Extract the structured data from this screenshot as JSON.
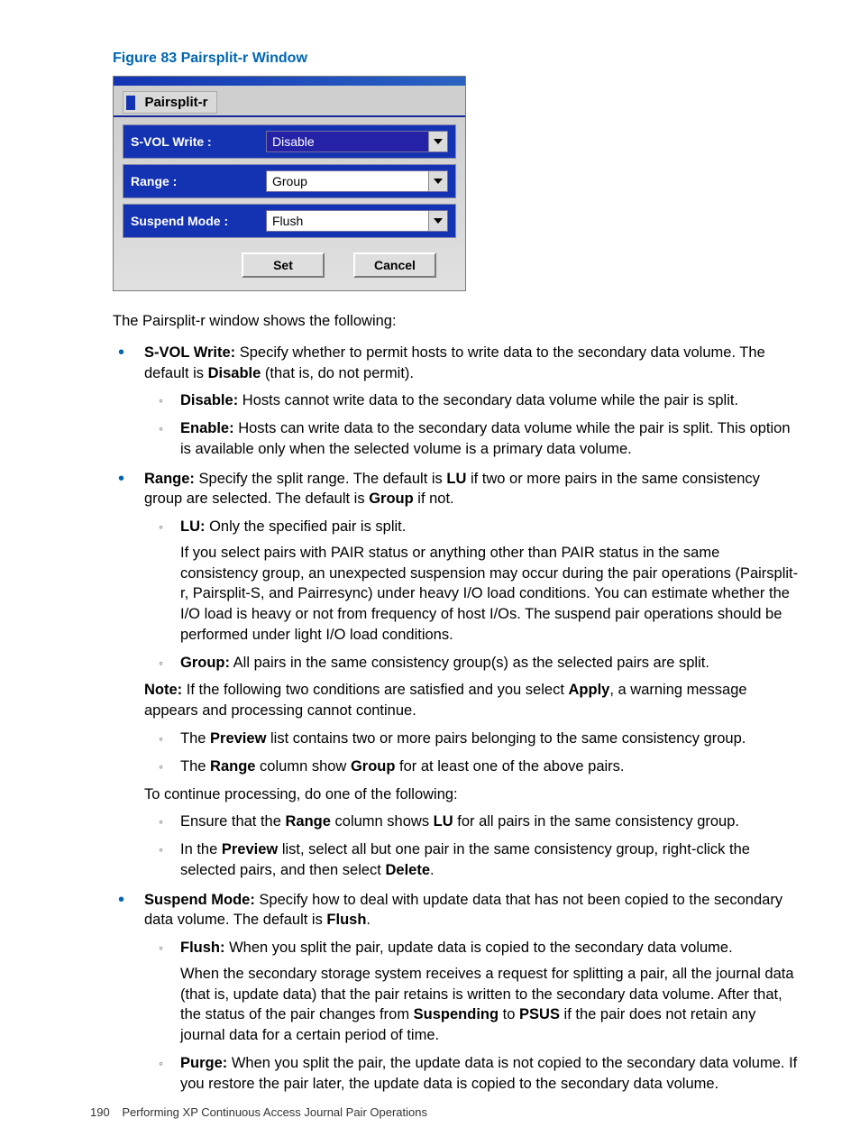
{
  "figure": {
    "caption": "Figure 83 Pairsplit-r Window"
  },
  "dialog": {
    "tab_label": "Pairsplit-r",
    "rows": {
      "svol": {
        "label": "S-VOL Write :",
        "value": "Disable"
      },
      "range": {
        "label": "Range :",
        "value": "Group"
      },
      "suspend": {
        "label": "Suspend Mode :",
        "value": "Flush"
      }
    },
    "buttons": {
      "set": "Set",
      "cancel": "Cancel"
    }
  },
  "intro": "The Pairsplit-r window shows the following:",
  "items": {
    "svol": {
      "term": "S-VOL Write:",
      "text_a": " Specify whether to permit hosts to write data to the secondary data volume. The default is ",
      "bold_a": "Disable",
      "text_b": " (that is, do not permit).",
      "disable_term": "Disable:",
      "disable_text": " Hosts cannot write data to the secondary data volume while the pair is split.",
      "enable_term": "Enable:",
      "enable_text": " Hosts can write data to the secondary data volume while the pair is split. This option is available only when the selected volume is a primary data volume."
    },
    "range": {
      "term": "Range:",
      "text_a": " Specify the split range. The default is ",
      "bold_a": "LU",
      "text_b": " if two or more pairs in the same consistency group are selected. The default is ",
      "bold_b": "Group",
      "text_c": " if not.",
      "lu_term": "LU:",
      "lu_text": " Only the specified pair is split.",
      "lu_para": "If you select pairs with PAIR status or anything other than PAIR status in the same consistency group, an unexpected suspension may occur during the pair operations (Pairsplit-r, Pairsplit-S, and Pairresync) under heavy I/O load conditions. You can estimate whether the I/O load is heavy or not from frequency of host I/Os. The suspend pair operations should be performed under light I/O load conditions.",
      "group_term": "Group:",
      "group_text": " All pairs in the same consistency group(s) as the selected pairs are split.",
      "note_term": "Note:",
      "note_text_a": " If the following two conditions are satisfied and you select ",
      "note_bold": "Apply",
      "note_text_b": ", a warning message appears and processing cannot continue.",
      "cond1_a": "The ",
      "cond1_b": "Preview",
      "cond1_c": " list contains two or more pairs belonging to the same consistency group.",
      "cond2_a": "The ",
      "cond2_b": "Range",
      "cond2_c": " column show ",
      "cond2_d": "Group",
      "cond2_e": " for at least one of the above pairs.",
      "continue_text": "To continue processing, do one of the following:",
      "fix1_a": "Ensure that the ",
      "fix1_b": "Range",
      "fix1_c": " column shows ",
      "fix1_d": "LU",
      "fix1_e": " for all pairs in the same consistency group.",
      "fix2_a": "In the ",
      "fix2_b": "Preview",
      "fix2_c": " list, select all but one pair in the same consistency group, right-click the selected pairs, and then select ",
      "fix2_d": "Delete",
      "fix2_e": "."
    },
    "suspend": {
      "term": "Suspend Mode:",
      "text_a": " Specify how to deal with update data that has not been copied to the secondary data volume. The default is ",
      "bold_a": "Flush",
      "text_b": ".",
      "flush_term": "Flush:",
      "flush_text": " When you split the pair, update data is copied to the secondary data volume.",
      "flush_para_a": "When the secondary storage system receives a request for splitting a pair, all the journal data (that is, update data) that the pair retains is written to the secondary data volume. After that, the status of the pair changes from ",
      "flush_para_b": "Suspending",
      "flush_para_c": " to ",
      "flush_para_d": "PSUS",
      "flush_para_e": " if the pair does not retain any journal data for a certain period of time.",
      "purge_term": "Purge:",
      "purge_text": " When you split the pair, the update data is not copied to the secondary data volume. If you restore the pair later, the update data is copied to the secondary data volume."
    }
  },
  "footer": {
    "page": "190",
    "section": "Performing XP Continuous Access Journal Pair Operations"
  }
}
